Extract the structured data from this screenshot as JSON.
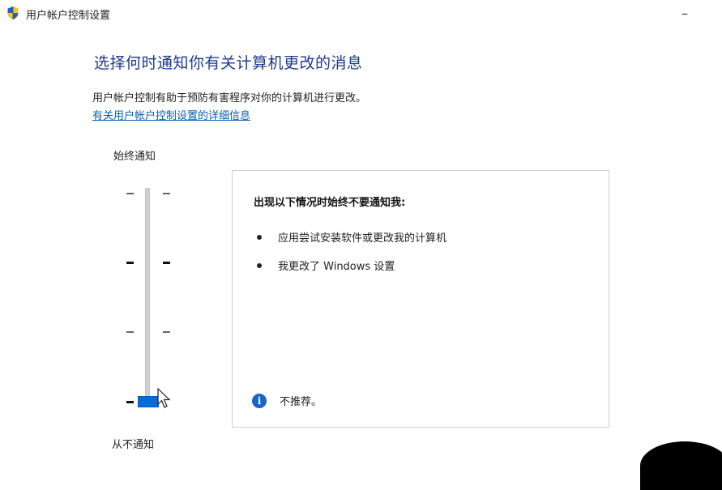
{
  "window": {
    "title": "用户帐户控制设置",
    "icon": "shield-icon",
    "minimize_label": "–"
  },
  "main": {
    "heading": "选择何时通知你有关计算机更改的消息",
    "description": "用户帐户控制有助于预防有害程序对你的计算机进行更改。",
    "link": "有关用户帐户控制设置的详细信息"
  },
  "slider": {
    "top_label": "始终通知",
    "bottom_label": "从不通知",
    "levels": 4,
    "current_level": 1,
    "accent_color": "#0a6ad6"
  },
  "info_panel": {
    "title": "出现以下情况时始终不要通知我:",
    "bullets": [
      "应用尝试安装软件或更改我的计算机",
      "我更改了 Windows 设置"
    ],
    "note": "不推荐。",
    "note_icon": "info-icon"
  }
}
